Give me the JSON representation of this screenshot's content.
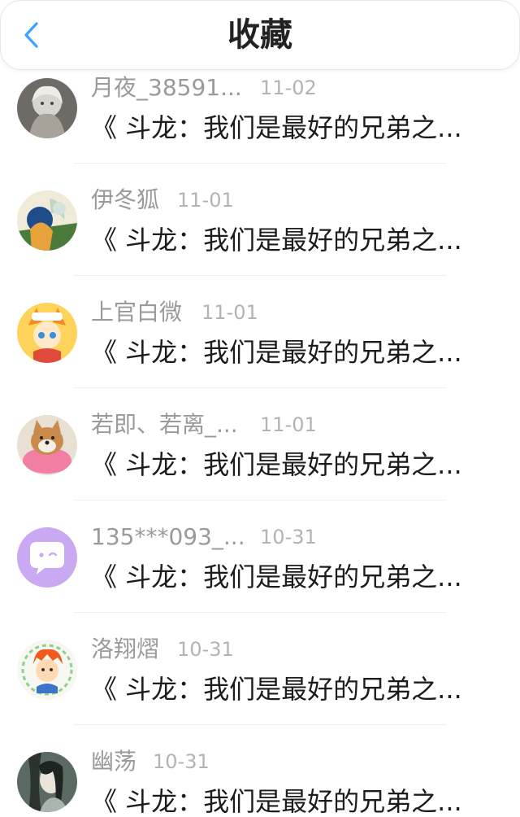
{
  "header": {
    "title": "收藏",
    "back_icon": "chevron-left-icon",
    "accent_color": "#3aa3ff"
  },
  "items": [
    {
      "username": "月夜_38591...",
      "date": "11-02",
      "content": "《 斗龙：我们是最好的兄弟之..."
    },
    {
      "username": "伊冬狐",
      "date": "11-01",
      "content": "《 斗龙：我们是最好的兄弟之..."
    },
    {
      "username": "上官白微",
      "date": "11-01",
      "content": "《 斗龙：我们是最好的兄弟之..."
    },
    {
      "username": "若即、若离_...",
      "date": "11-01",
      "content": "《 斗龙：我们是最好的兄弟之..."
    },
    {
      "username": "135***093_...",
      "date": "10-31",
      "content": "《 斗龙：我们是最好的兄弟之..."
    },
    {
      "username": "洛翔熠",
      "date": "10-31",
      "content": "《 斗龙：我们是最好的兄弟之..."
    },
    {
      "username": "幽荡",
      "date": "10-31",
      "content": "《 斗龙：我们是最好的兄弟之..."
    }
  ]
}
